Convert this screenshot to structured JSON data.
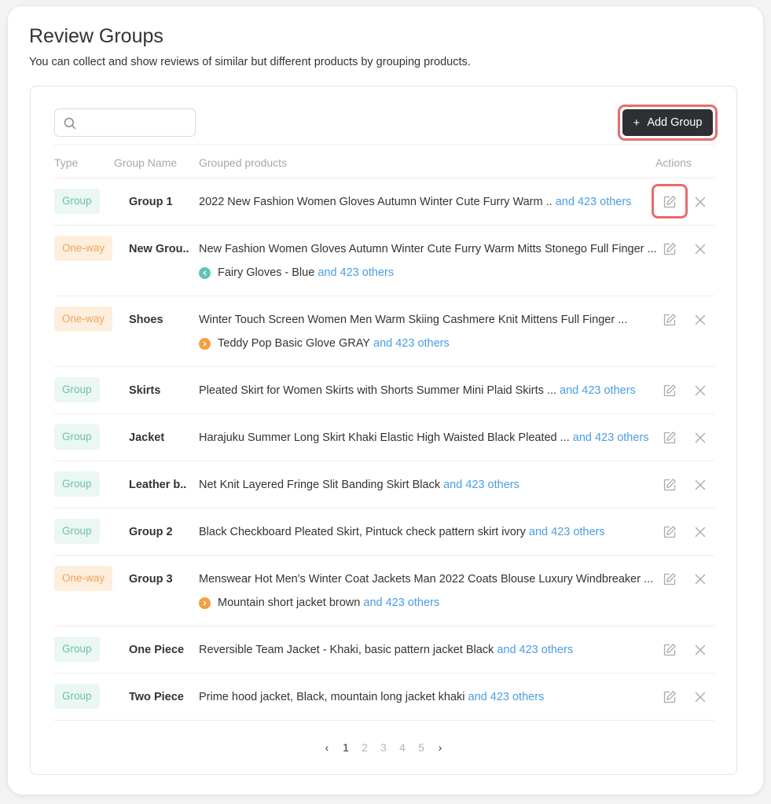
{
  "page": {
    "title": "Review Groups",
    "description": "You can collect and show reviews of similar but different products by grouping products."
  },
  "toolbar": {
    "search_placeholder": "",
    "add_group_label": "Add Group",
    "add_group_icon": "+"
  },
  "table": {
    "headers": {
      "type": "Type",
      "group_name": "Group Name",
      "grouped_products": "Grouped products",
      "actions": "Actions"
    },
    "rows": [
      {
        "type": "Group",
        "name": "Group 1",
        "product": "2022 New Fashion Women Gloves Autumn Winter Cute Furry Warm ..",
        "others": "and 423 others"
      },
      {
        "type": "One-way",
        "name": "New Grou..",
        "product": "New Fashion Women Gloves Autumn Winter Cute Furry Warm Mitts Stonego Full Finger ...",
        "sub_product": "Fairy Gloves - Blue",
        "sub_icon": "chevron-left-icon",
        "sub_color": "#5fc6b3",
        "sub_others": "and 423 others"
      },
      {
        "type": "One-way",
        "name": "Shoes",
        "product": "Winter Touch Screen Women Men Warm Skiing Cashmere Knit Mittens Full Finger ...",
        "sub_product": "Teddy Pop Basic Glove GRAY",
        "sub_icon": "chevron-right-icon",
        "sub_color": "#f3a040",
        "sub_others": "and 423 others"
      },
      {
        "type": "Group",
        "name": "Skirts",
        "product": "Pleated Skirt for Women Skirts with Shorts Summer Mini Plaid Skirts ...",
        "others": "and 423 others"
      },
      {
        "type": "Group",
        "name": "Jacket",
        "product": "Harajuku Summer Long Skirt Khaki Elastic High Waisted Black Pleated ...",
        "others": "and 423 others"
      },
      {
        "type": "Group",
        "name": "Leather b..",
        "product": "Net Knit Layered Fringe Slit Banding Skirt Black",
        "others": "and 423 others"
      },
      {
        "type": "Group",
        "name": "Group 2",
        "product": "Black Checkboard Pleated Skirt, Pintuck check pattern skirt ivory ",
        "others": "and 423 others"
      },
      {
        "type": "One-way",
        "name": "Group 3",
        "product": "Menswear Hot Men's Winter Coat Jackets Man 2022 Coats Blouse Luxury Windbreaker ...",
        "sub_product": "Mountain short jacket brown",
        "sub_icon": "chevron-right-icon",
        "sub_color": "#f3a040",
        "sub_others": "and 423 others"
      },
      {
        "type": "Group",
        "name": "One Piece",
        "product": "Reversible Team Jacket - Khaki, basic pattern jacket Black",
        "others": "and 423 others"
      },
      {
        "type": "Group",
        "name": "Two Piece",
        "product": "Prime hood jacket, Black, mountain long jacket khaki",
        "others": "and 423 others"
      }
    ]
  },
  "pagination": {
    "prev": "‹",
    "pages": [
      "1",
      "2",
      "3",
      "4",
      "5"
    ],
    "active": "1",
    "next": "›"
  },
  "icons": {
    "search": "search-icon",
    "edit": "edit-icon",
    "delete": "close-icon"
  },
  "colors": {
    "accent_link": "#4a9de4",
    "group_badge_text": "#6cc3a0",
    "group_badge_bg": "#eaf7f2",
    "oneway_badge_text": "#eea45c",
    "oneway_badge_bg": "#fdeedd",
    "primary_button": "#2d2f33",
    "highlight": "#e96b6b"
  }
}
